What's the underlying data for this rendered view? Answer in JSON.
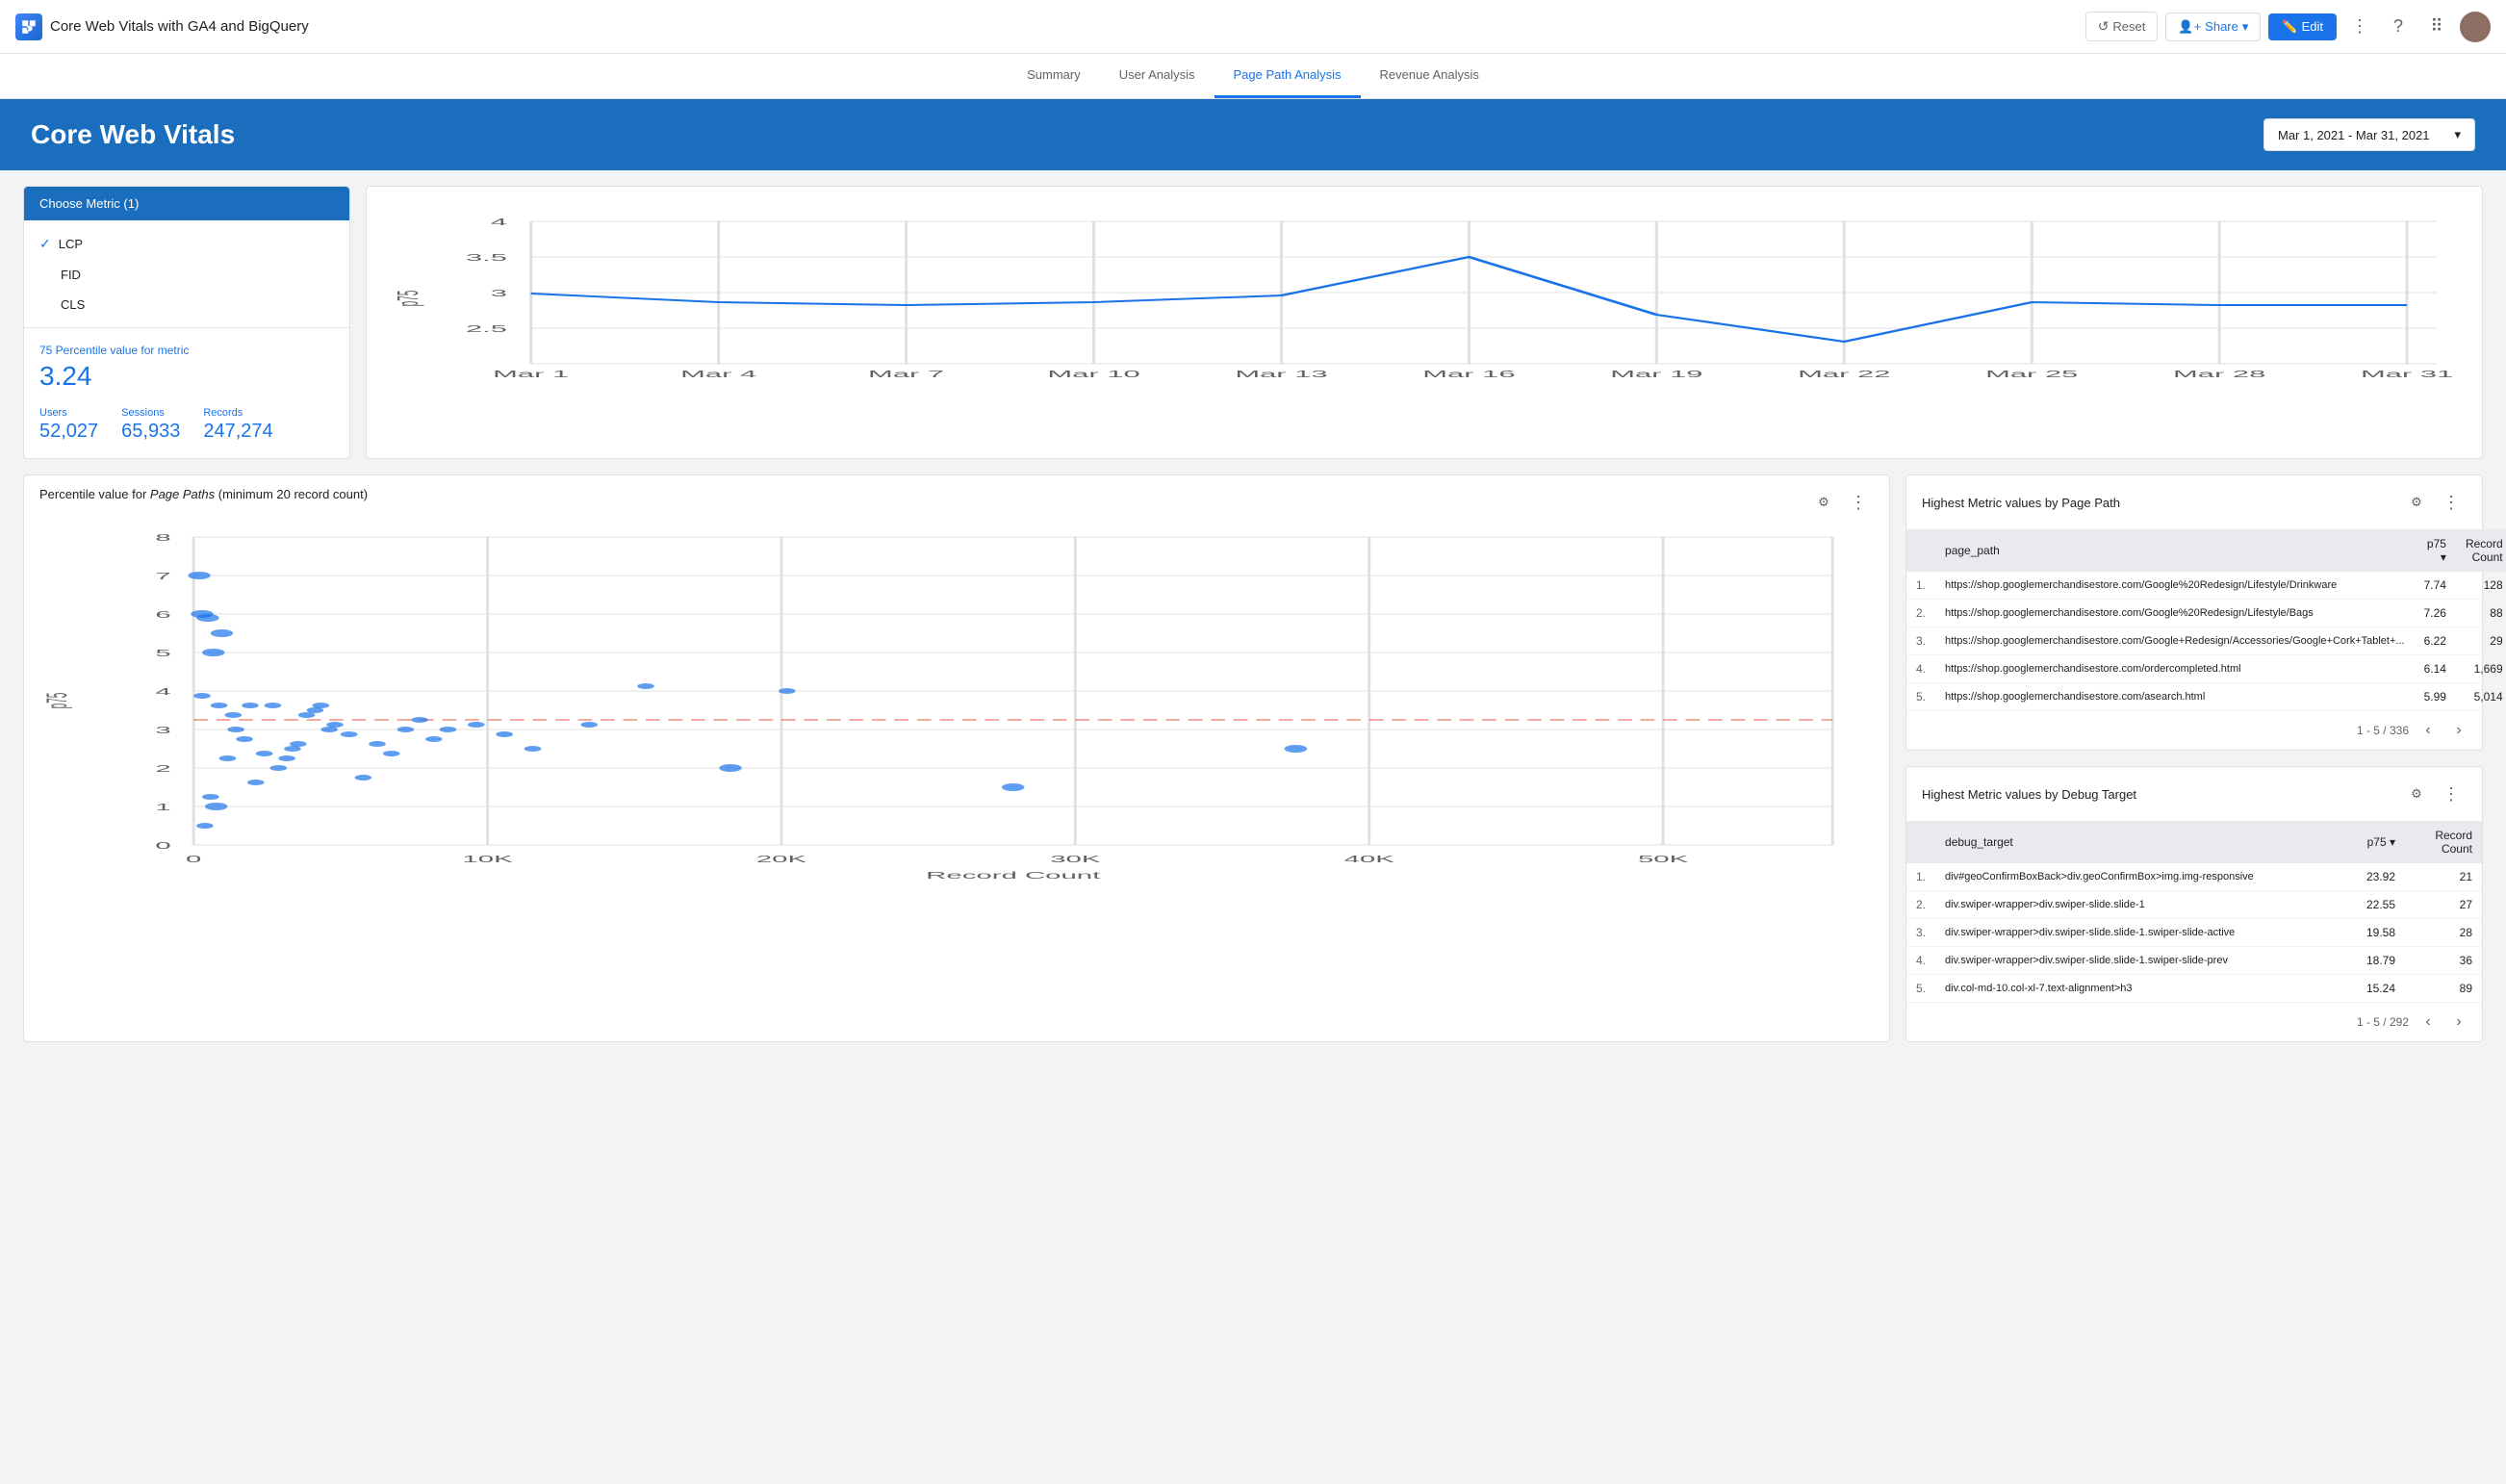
{
  "app": {
    "title": "Core Web Vitals with GA4 and BigQuery",
    "logo_text": "DS"
  },
  "topbar": {
    "reset_label": "Reset",
    "share_label": "Share",
    "edit_label": "Edit"
  },
  "tabs": [
    {
      "label": "Summary",
      "active": false
    },
    {
      "label": "User Analysis",
      "active": false
    },
    {
      "label": "Page Path Analysis",
      "active": true
    },
    {
      "label": "Revenue Analysis",
      "active": false
    }
  ],
  "banner": {
    "title": "Core Web Vitals",
    "date_range": "Mar 1, 2021 - Mar 31, 2021"
  },
  "metric_selector": {
    "header": "Choose Metric (1)",
    "items": [
      {
        "label": "LCP",
        "selected": true
      },
      {
        "label": "FID",
        "selected": false
      },
      {
        "label": "CLS",
        "selected": false
      }
    ]
  },
  "metric_stats": {
    "percentile_label": "75 Percentile value for metric",
    "percentile_value": "3.24",
    "users_label": "Users",
    "users_value": "52,027",
    "sessions_label": "Sessions",
    "sessions_value": "65,933",
    "records_label": "Records",
    "records_value": "247,274"
  },
  "line_chart": {
    "y_axis": [
      4,
      3.5,
      3,
      2.5
    ],
    "x_labels": [
      "Mar 1",
      "Mar 4",
      "Mar 7",
      "Mar 10",
      "Mar 13",
      "Mar 16",
      "Mar 19",
      "Mar 22",
      "Mar 25",
      "Mar 28",
      "Mar 31"
    ],
    "y_label": "p75"
  },
  "scatter_chart": {
    "title_prefix": "Percentile value for ",
    "title_italic": "Page Paths",
    "title_suffix": " (minimum 20 record count)",
    "x_label": "Record Count",
    "y_label": "p75",
    "y_ticks": [
      0,
      1,
      2,
      3,
      4,
      5,
      6,
      7,
      8
    ],
    "x_ticks": [
      "0",
      "10K",
      "20K",
      "30K",
      "40K",
      "50K"
    ]
  },
  "highest_metric_page_path": {
    "title": "Highest Metric values by Page Path",
    "col_page_path": "page_path",
    "col_p75": "p75 ▾",
    "col_record_count": "Record Count",
    "rows": [
      {
        "num": "1.",
        "path": "https://shop.googlemerchandisestore.com/Google%20Redesign/Lifestyle/Drinkware",
        "p75": "7.74",
        "count": "128"
      },
      {
        "num": "2.",
        "path": "https://shop.googlemerchandisestore.com/Google%20Redesign/Lifestyle/Bags",
        "p75": "7.26",
        "count": "88"
      },
      {
        "num": "3.",
        "path": "https://shop.googlemerchandisestore.com/Google+Redesign/Accessories/Google+Cork+Tablet+...",
        "p75": "6.22",
        "count": "29"
      },
      {
        "num": "4.",
        "path": "https://shop.googlemerchandisestore.com/ordercompleted.html",
        "p75": "6.14",
        "count": "1,669"
      },
      {
        "num": "5.",
        "path": "https://shop.googlemerchandisestore.com/asearch.html",
        "p75": "5.99",
        "count": "5,014"
      }
    ],
    "pagination": "1 - 5 / 336"
  },
  "highest_metric_debug": {
    "title": "Highest Metric values by Debug Target",
    "col_debug_target": "debug_target",
    "col_p75": "p75 ▾",
    "col_record_count": "Record Count",
    "rows": [
      {
        "num": "1.",
        "target": "div#geoConfirmBoxBack>div.geoConfirmBox>img.img-responsive",
        "p75": "23.92",
        "count": "21"
      },
      {
        "num": "2.",
        "target": "div.swiper-wrapper>div.swiper-slide.slide-1",
        "p75": "22.55",
        "count": "27"
      },
      {
        "num": "3.",
        "target": "div.swiper-wrapper>div.swiper-slide.slide-1.swiper-slide-active",
        "p75": "19.58",
        "count": "28"
      },
      {
        "num": "4.",
        "target": "div.swiper-wrapper>div.swiper-slide.slide-1.swiper-slide-prev",
        "p75": "18.79",
        "count": "36"
      },
      {
        "num": "5.",
        "target": "div.col-md-10.col-xl-7.text-alignment>h3",
        "p75": "15.24",
        "count": "89"
      }
    ],
    "pagination": "1 - 5 / 292"
  }
}
